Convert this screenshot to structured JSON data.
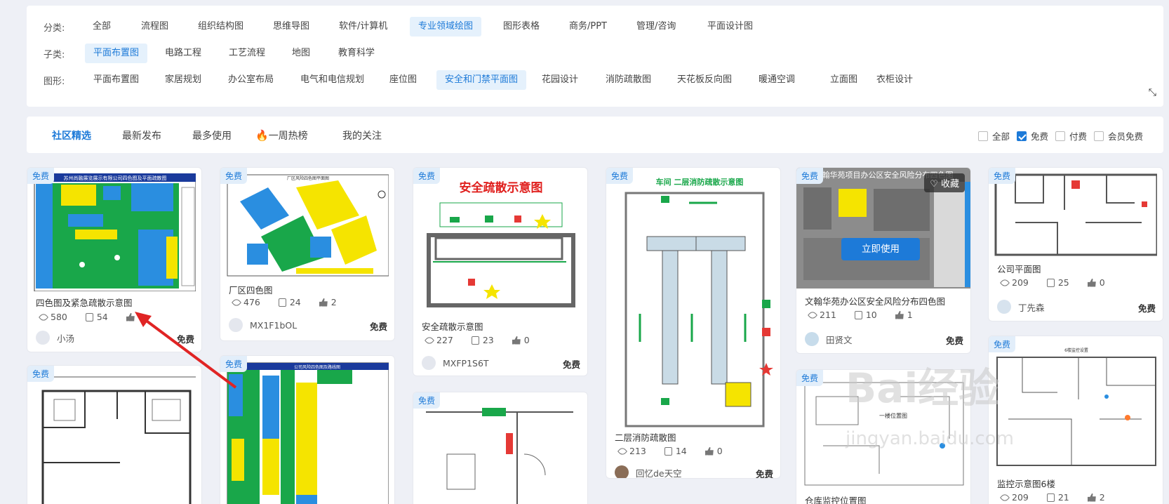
{
  "filters": {
    "category": {
      "label": "分类:",
      "items": [
        "全部",
        "流程图",
        "组织结构图",
        "思维导图",
        "软件/计算机",
        "专业领域绘图",
        "图形表格",
        "商务/PPT",
        "管理/咨询",
        "平面设计图"
      ],
      "active": 5
    },
    "subcategory": {
      "label": "子类:",
      "items": [
        "平面布置图",
        "电路工程",
        "工艺流程",
        "地图",
        "教育科学"
      ],
      "active": 0
    },
    "shape": {
      "label": "图形:",
      "items": [
        "平面布置图",
        "家居规划",
        "办公室布局",
        "电气和电信规划",
        "座位图",
        "安全和门禁平面图",
        "花园设计",
        "消防疏散图",
        "天花板反向图",
        "暖通空调",
        "立面图",
        "衣柜设计"
      ],
      "active": 5
    }
  },
  "tabs": [
    "社区精选",
    "最新发布",
    "最多使用",
    "一周热榜",
    "我的关注"
  ],
  "price_filters": [
    {
      "label": "全部",
      "checked": false
    },
    {
      "label": "免费",
      "checked": true
    },
    {
      "label": "付费",
      "checked": false
    },
    {
      "label": "会员免费",
      "checked": false
    }
  ],
  "badge_free": "免费",
  "cards": [
    {
      "title": "四色图及紧急疏散示意图",
      "thumb_title": "苏州尚融展览展示有限公司四色图及平面疏散图",
      "views": "580",
      "copies": "54",
      "likes": "",
      "author": "小汤",
      "price": "免费"
    },
    {
      "title": "厂区四色图",
      "thumb_title": "厂区风险四色图平面图",
      "views": "476",
      "copies": "24",
      "likes": "2",
      "author": "MX1F1bOL",
      "price": "免费"
    },
    {
      "title": "安全疏散示意图",
      "thumb_title": "安全疏散示意图",
      "views": "227",
      "copies": "23",
      "likes": "0",
      "author": "MXFP1S6T",
      "price": "免费"
    },
    {
      "title": "二层消防疏散图",
      "thumb_title": "车间 二层消防疏散示意图",
      "views": "213",
      "copies": "14",
      "likes": "0",
      "author": "回忆de天空",
      "price": "免费"
    },
    {
      "title": "文翰华苑办公区安全风险分布四色图",
      "thumb_title": "翰华苑项目办公区安全风险分布四色图",
      "views": "211",
      "copies": "10",
      "likes": "1",
      "author": "田贤文",
      "price": "免费",
      "fav": "收藏",
      "use": "立即使用"
    },
    {
      "title": "公司平面图",
      "views": "209",
      "copies": "25",
      "likes": "0",
      "author": "丁先森",
      "price": "免费"
    },
    {
      "title": "",
      "thumb_title": "公司风险四色图及路线图"
    },
    {
      "title": "仓库监控位置图",
      "thumb_title": "一楼位置图"
    },
    {
      "title": "监控示意图6楼",
      "thumb_title": "6楼监控设置",
      "views": "209",
      "copies": "21",
      "likes": "2"
    }
  ],
  "colors": {
    "accent": "#1d7ad8",
    "green": "#19a74a",
    "yellow": "#f5e400",
    "blue": "#2a8ee0",
    "red": "#e53935"
  },
  "watermark": "Bai经验",
  "watermark_sub": "jingyan.baidu.com"
}
